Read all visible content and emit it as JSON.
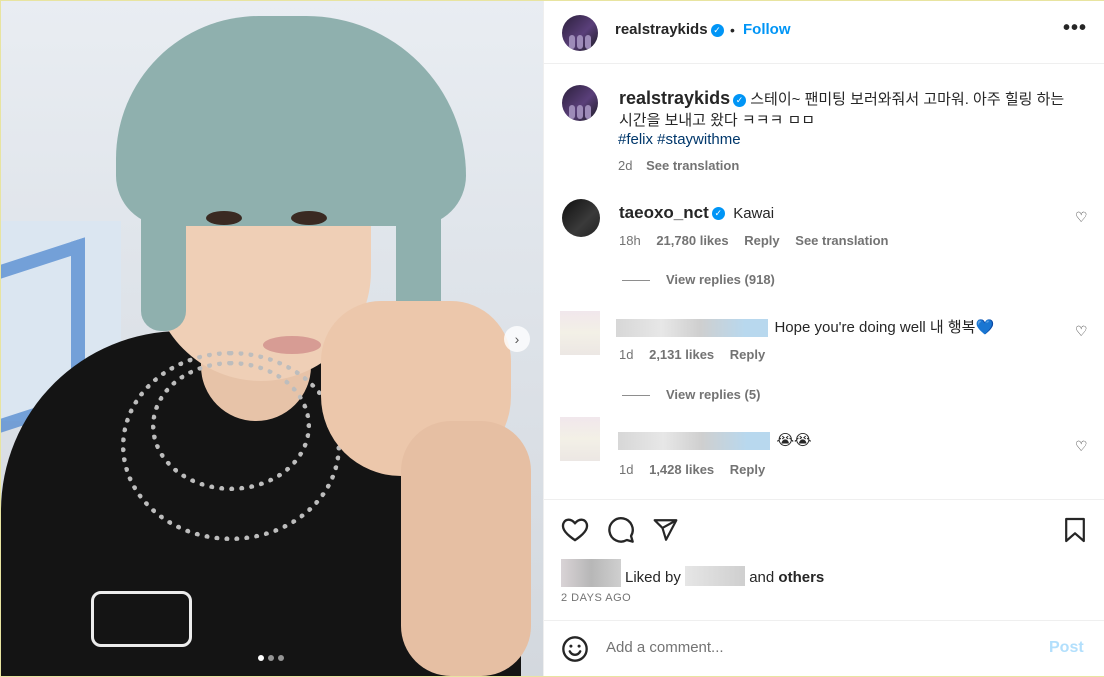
{
  "post": {
    "image_alt": "selfie",
    "carousel_next_icon": "chevron-right-icon",
    "dots": [
      true,
      false,
      false
    ]
  },
  "header": {
    "username": "realstraykids",
    "separator": "•",
    "follow_label": "Follow",
    "more_icon": "•••"
  },
  "caption": {
    "username": "realstraykids",
    "text": "스테이~ 팬미팅 보러와줘서 고마워. 아주 힐링 하는 시간을 보내고 왔다 ㅋㅋㅋ ㅁㅁ",
    "hashtags": "#felix #staywithme",
    "time": "2d",
    "see_translation": "See translation"
  },
  "comments": [
    {
      "username": "taeoxo_nct",
      "text": "Kawai",
      "time": "18h",
      "likes": "21,780 likes",
      "reply": "Reply",
      "see_translation": "See translation",
      "view_replies": "View replies (918)"
    },
    {
      "username": "",
      "text": "Hope you're doing well 내 행복💙",
      "time": "1d",
      "likes": "2,131 likes",
      "reply": "Reply",
      "view_replies": "View replies (5)"
    },
    {
      "username": "",
      "text": "😭😭",
      "time": "1d",
      "likes": "1,428 likes",
      "reply": "Reply"
    }
  ],
  "actions": {
    "like_icon": "heart-icon",
    "comment_icon": "comment-icon",
    "share_icon": "send-icon",
    "save_icon": "bookmark-icon"
  },
  "likes": {
    "prefix": "Liked by",
    "and": "and",
    "others": "others"
  },
  "post_time": "2 DAYS AGO",
  "comment_box": {
    "emoji_icon": "emoji-icon",
    "placeholder": "Add a comment...",
    "post_label": "Post"
  },
  "colors": {
    "accent": "#0095f6",
    "hashtag": "#00376b",
    "muted": "#737373",
    "post_disabled": "#b2dffc"
  }
}
